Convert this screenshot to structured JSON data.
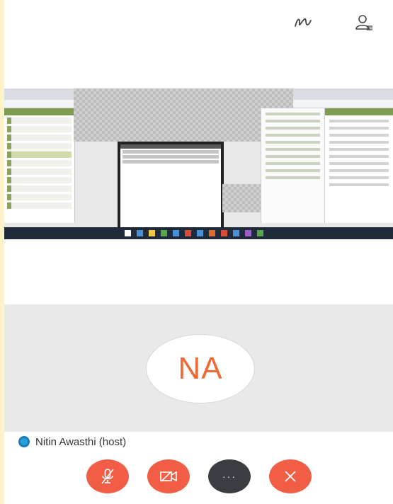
{
  "toolbar": {
    "annotate_icon": "annotate-icon",
    "participants_icon": "participants-icon"
  },
  "shared_screen": {
    "description_icon": "screen-share-content"
  },
  "video_tile": {
    "initials": "NA"
  },
  "participant": {
    "name": "Nitin Awasthi (host)"
  },
  "controls": {
    "more_label": "···"
  },
  "colors": {
    "accent": "#ee6a36",
    "button_red": "#f15d45",
    "button_dark": "#3a3d42",
    "status_blue": "#1a7cc0"
  }
}
